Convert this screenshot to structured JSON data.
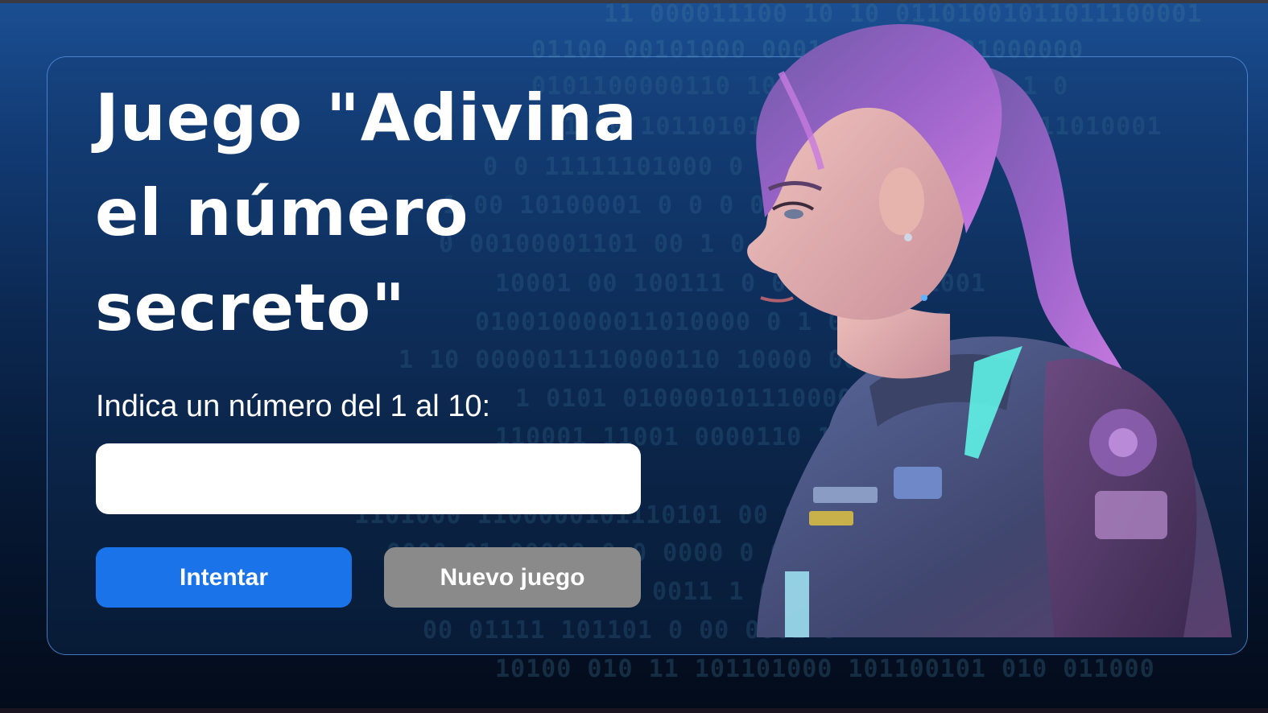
{
  "background": {
    "binary_lines": [
      "11 000011100 10 10 01101001011011100001",
      "01100 00101000 0001 0010101001000000",
      "0101100000110 101 0 00  0011011 1 0",
      "1 00 10110101000 0 0 1 00 00 1011010001",
      "0 0 11111101000 0 0 1 00 000011 0 0",
      "1 00 10100001 0 0 0 0 1 00 00 0010",
      "0 00100001101 00 1 0 0 1 0 00 0",
      "10001 00 100111 0 0 1 00 00 1001",
      "010010000011010000 0 1 00 0 001",
      "1 10 0000011110000110 10000 00 1",
      "1 0101 0100001011100000 00 01000",
      "110001 11001 0000110 10 000110",
      "1101000 1100000101110101 00 0101",
      "0000 01 00000 0 0 0000 0 00 01",
      "0011 1 0 0 0 001 0 1 00 0",
      "00 01111 101101 0 00 0001 0",
      "10100 010 11 101101000 101100101 010 011000"
    ]
  },
  "game": {
    "title": "Juego \"Adivina el número secreto\"",
    "prompt": "Indica un número del 1 al 10:",
    "input_value": "",
    "input_placeholder": "",
    "try_button": "Intentar",
    "new_game_button": "Nuevo juego"
  },
  "illustration": {
    "description_icon": "woman-astronaut-illustration"
  },
  "colors": {
    "accent": "#1a73e8",
    "secondary_button": "#8a8a8a",
    "card_border": "#5a96e6",
    "text": "#ffffff"
  }
}
